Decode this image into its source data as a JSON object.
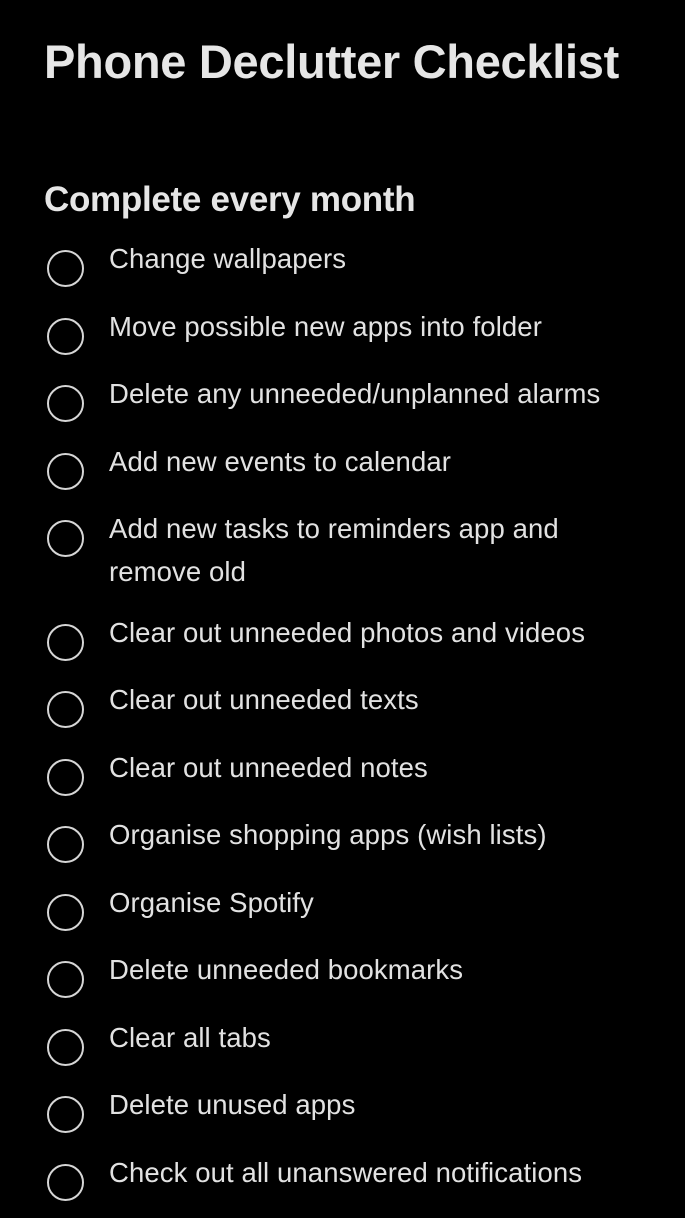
{
  "note": {
    "title": "Phone Declutter Checklist",
    "subtitle": "Complete every month",
    "checklist_icon": "empty-circle-icon",
    "items": [
      {
        "label": "Change wallpapers",
        "checked": false
      },
      {
        "label": "Move possible new apps into folder",
        "checked": false
      },
      {
        "label": "Delete any unneeded/unplanned alarms",
        "checked": false
      },
      {
        "label": "Add new events to calendar",
        "checked": false
      },
      {
        "label": "Add new tasks to reminders app and remove old",
        "checked": false
      },
      {
        "label": "Clear out unneeded photos and videos",
        "checked": false
      },
      {
        "label": "Clear out unneeded texts",
        "checked": false
      },
      {
        "label": "Clear out unneeded notes",
        "checked": false
      },
      {
        "label": "Organise shopping apps (wish lists)",
        "checked": false
      },
      {
        "label": "Organise Spotify",
        "checked": false
      },
      {
        "label": "Delete unneeded bookmarks",
        "checked": false
      },
      {
        "label": "Clear all tabs",
        "checked": false
      },
      {
        "label": "Delete unused apps",
        "checked": false
      },
      {
        "label": "Check out all unanswered notifications",
        "checked": false
      }
    ]
  },
  "colors": {
    "background": "#000000",
    "text": "#e4e4e4",
    "checkbox_outline": "#d6d6d6"
  }
}
